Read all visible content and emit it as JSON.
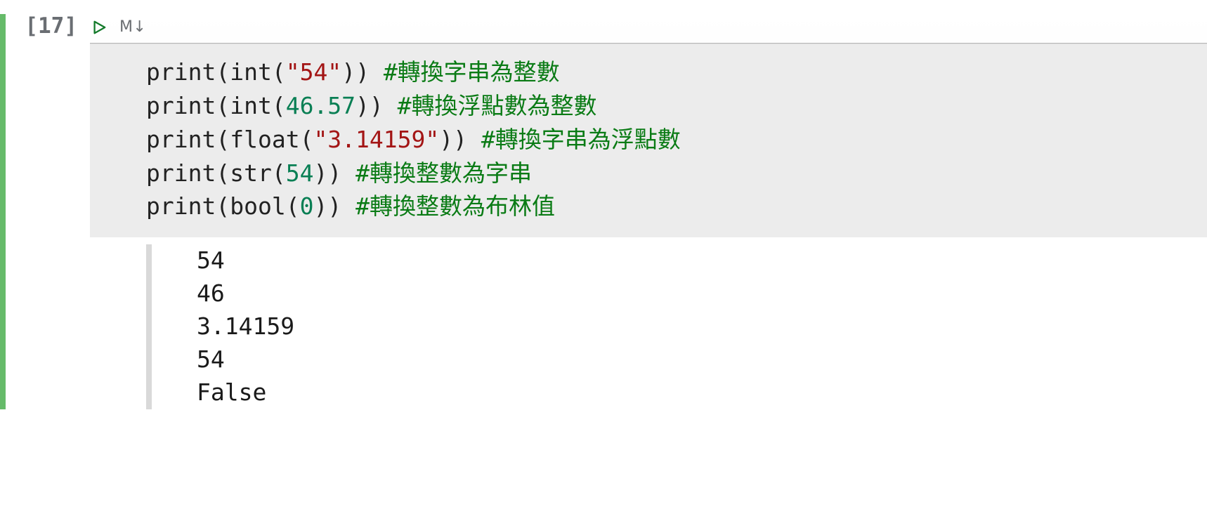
{
  "cell": {
    "exec_count_label": "[17]",
    "toolbar": {
      "markdown_label": "M↓",
      "run_icon_color": "#137a2a"
    },
    "code": {
      "lines": [
        {
          "fn": "print",
          "arg_fn": "int",
          "arg_open": "(",
          "arg_val": "\"54\"",
          "arg_type": "str",
          "arg_close": ")",
          "comment": "#轉換字串為整數"
        },
        {
          "fn": "print",
          "arg_fn": "int",
          "arg_open": "(",
          "arg_val": "46.57",
          "arg_type": "num",
          "arg_close": ")",
          "comment": "#轉換浮點數為整數"
        },
        {
          "fn": "print",
          "arg_fn": "float",
          "arg_open": "(",
          "arg_val": "\"3.14159\"",
          "arg_type": "str",
          "arg_close": ")",
          "comment": "#轉換字串為浮點數"
        },
        {
          "fn": "print",
          "arg_fn": "str",
          "arg_open": "(",
          "arg_val": "54",
          "arg_type": "num",
          "arg_close": ")",
          "comment": "#轉換整數為字串"
        },
        {
          "fn": "print",
          "arg_fn": "bool",
          "arg_open": "(",
          "arg_val": "0",
          "arg_type": "num",
          "arg_close": ")",
          "comment": "#轉換整數為布林值"
        }
      ]
    },
    "output": {
      "lines": [
        "54",
        "46",
        "3.14159",
        "54",
        "False"
      ]
    }
  }
}
